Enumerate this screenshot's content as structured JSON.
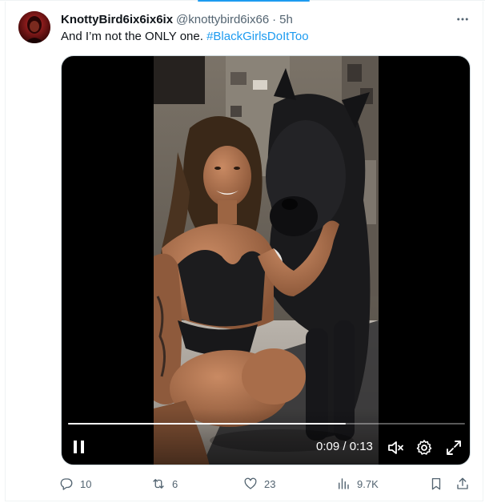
{
  "tweet": {
    "author_name": "KnottyBird6ix6ix6ix",
    "author_handle": "@knottybird6ix66",
    "separator": "·",
    "time": "5h",
    "text_plain": "And I’m not the ONLY one.",
    "hashtag": "#BlackGirlsDoItToo"
  },
  "video": {
    "timecode": "0:09 / 0:13",
    "progress_fraction": 0.7,
    "state": "playing"
  },
  "actions": {
    "replies": "10",
    "reposts": "6",
    "likes": "23",
    "views": "9.7K"
  },
  "icons": {
    "more": "more-icon",
    "pause": "pause-icon",
    "mute": "muted-speaker-icon",
    "settings": "gear-icon",
    "fullscreen": "fullscreen-icon",
    "reply": "reply-icon",
    "repost": "repost-icon",
    "like": "heart-icon",
    "views": "views-icon",
    "bookmark": "bookmark-icon",
    "share": "share-icon"
  },
  "colors": {
    "accent": "#1d9bf0",
    "secondary_text": "#536471",
    "primary_text": "#0f1419"
  }
}
